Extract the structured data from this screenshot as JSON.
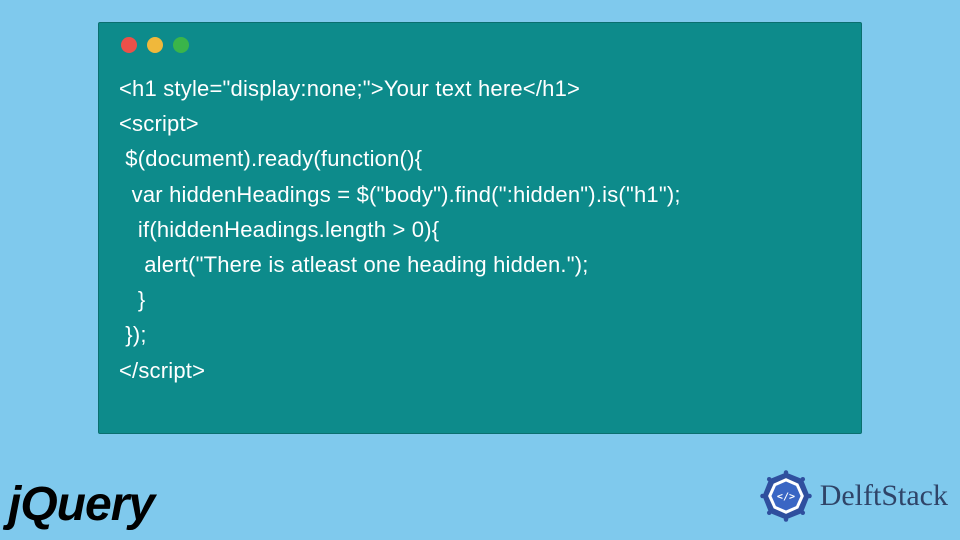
{
  "code": {
    "line1": "<h1 style=\"display:none;\">Your text here</h1>",
    "line2": "<script>",
    "line3": " $(document).ready(function(){",
    "line4": "  var hiddenHeadings = $(\"body\").find(\":hidden\").is(\"h1\");",
    "line5": "   if(hiddenHeadings.length > 0){",
    "line6": "    alert(\"There is atleast one heading hidden.\");",
    "line7": "   }",
    "line8": " });",
    "line9": "</script>"
  },
  "footer": {
    "left_logo_text": "jQuery",
    "right_brand_text": "DelftStack"
  },
  "colors": {
    "page_bg": "#7fc9ed",
    "window_bg": "#0d8b8b",
    "code_text": "#ffffff",
    "dot_red": "#ec5049",
    "dot_yellow": "#f0b83b",
    "dot_green": "#3ab54a",
    "brand_text": "#2f4468",
    "brand_icon_outer": "#2f4f9e",
    "brand_icon_inner": "#3a66c4"
  }
}
